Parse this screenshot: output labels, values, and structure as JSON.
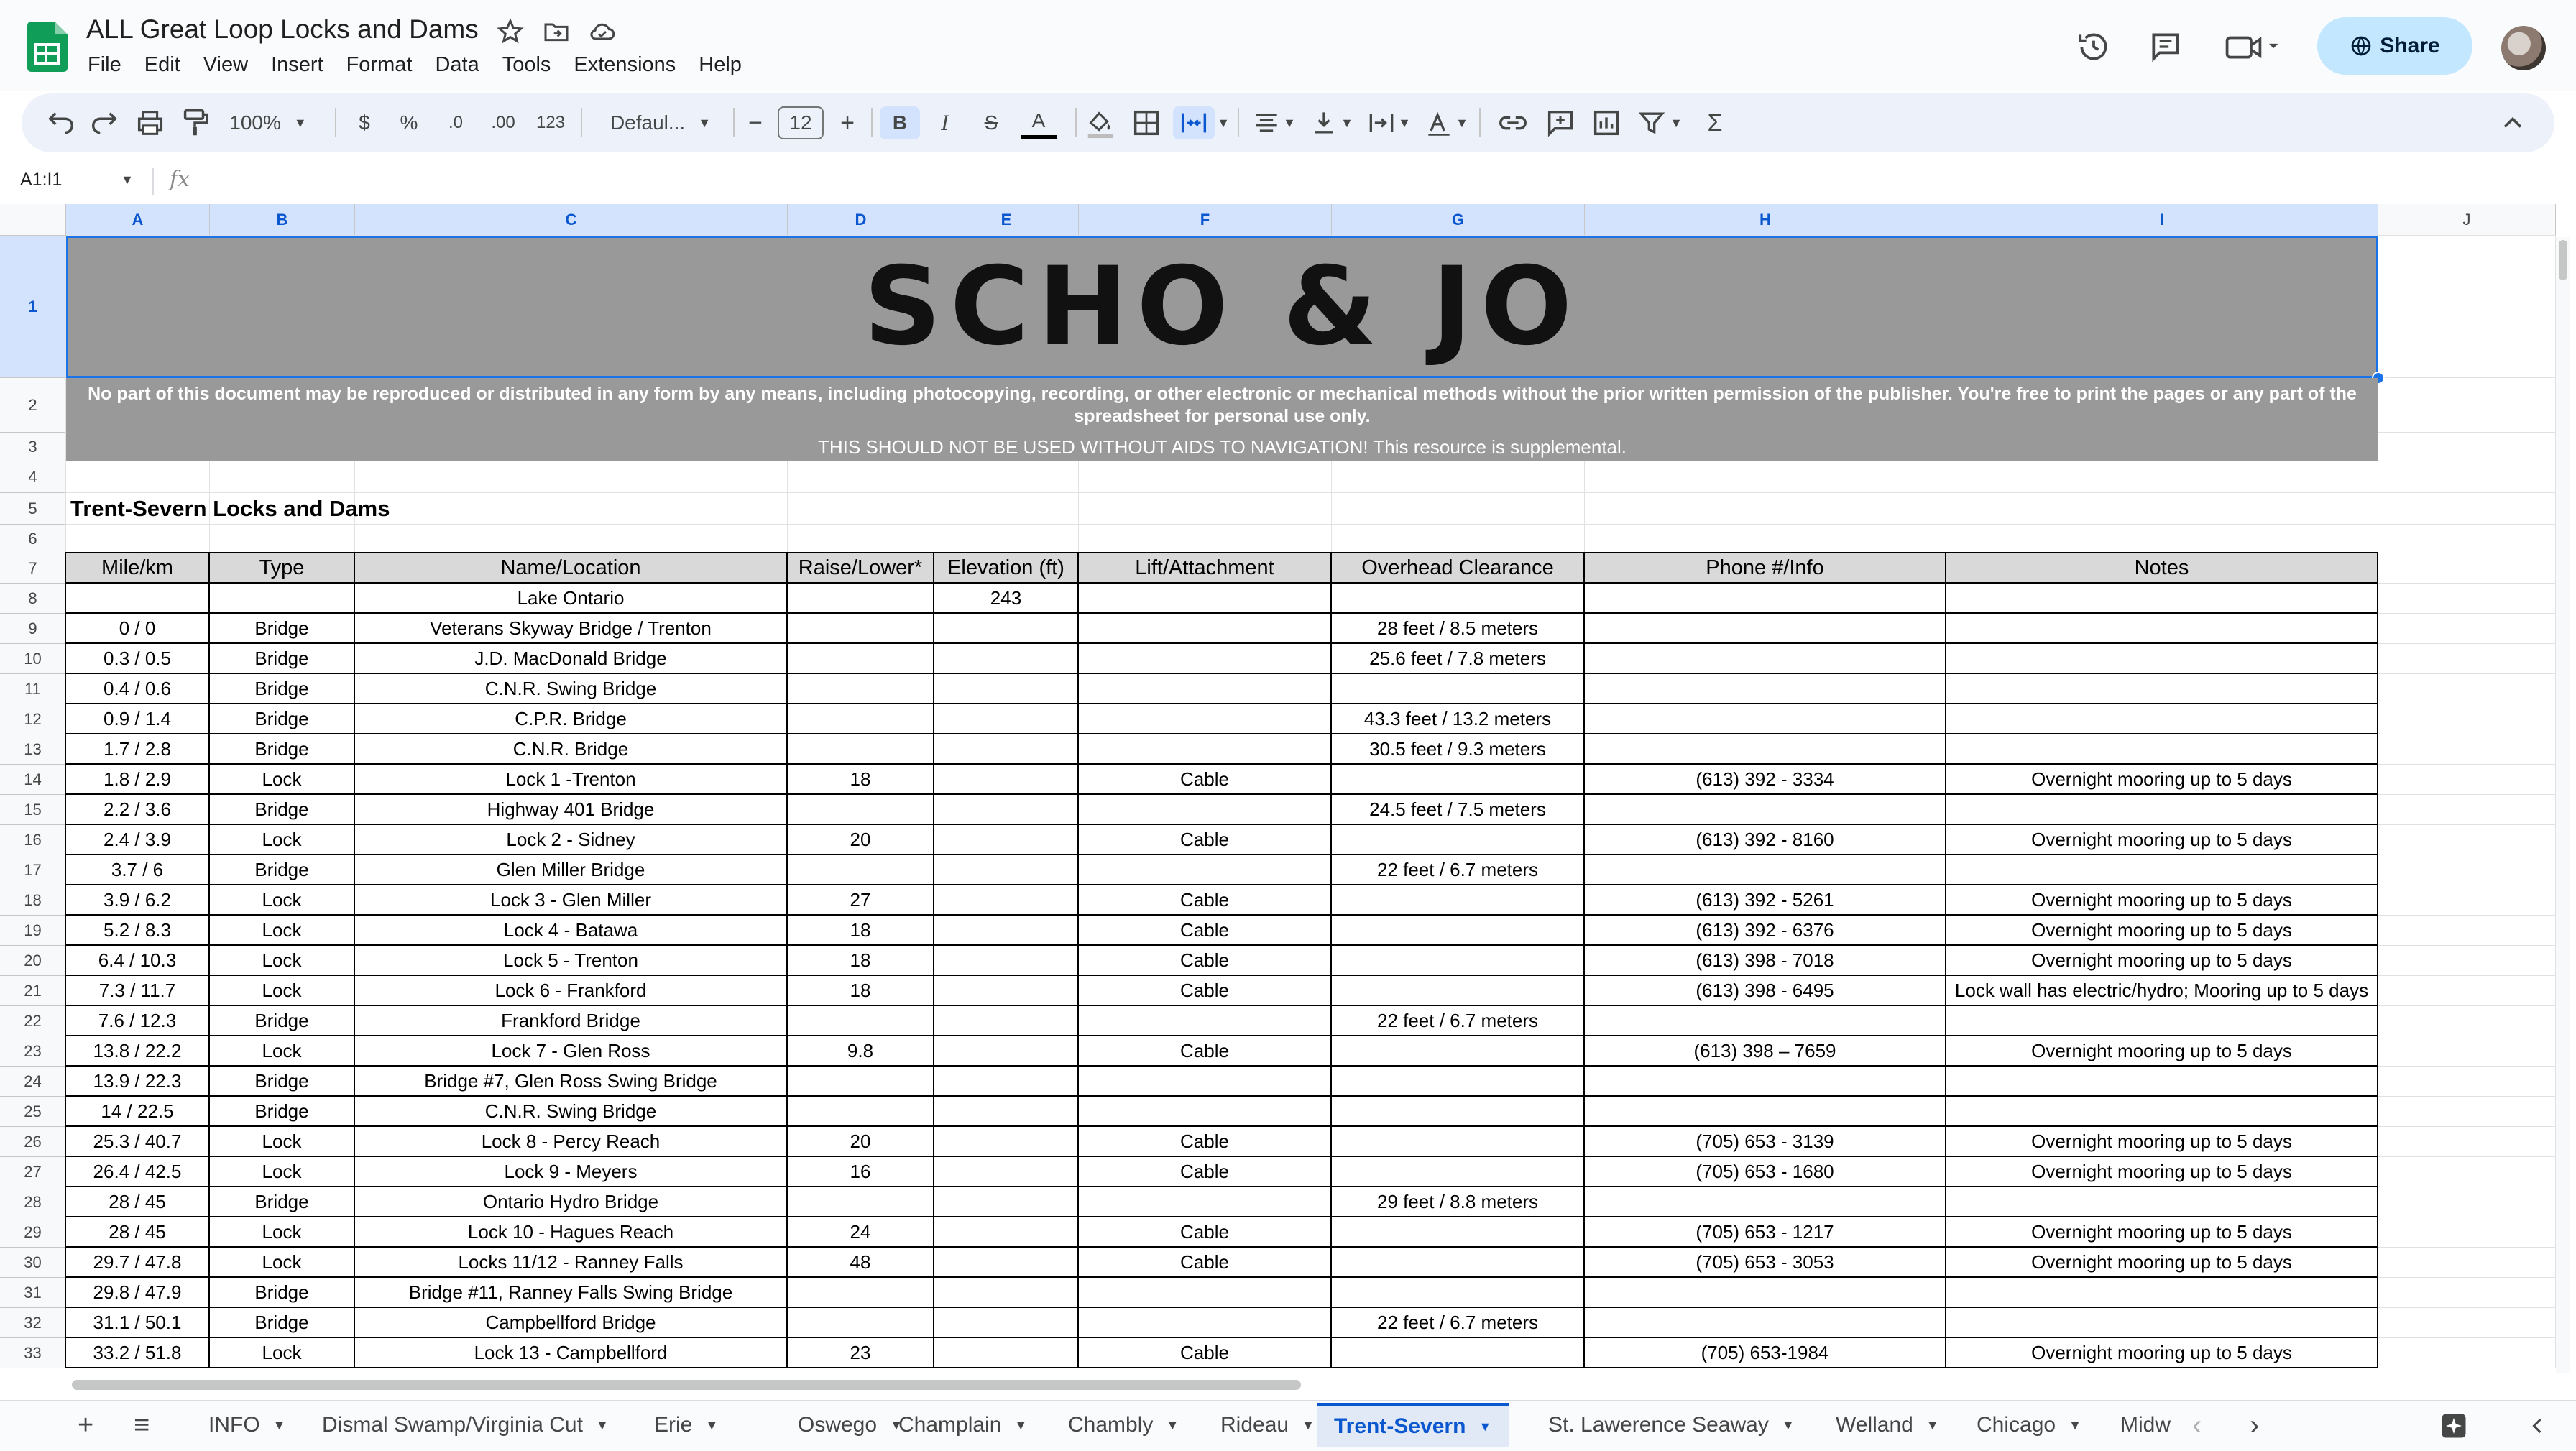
{
  "app": {
    "doc_title": "ALL Great Loop Locks and Dams",
    "menu": [
      "File",
      "Edit",
      "View",
      "Insert",
      "Format",
      "Data",
      "Tools",
      "Extensions",
      "Help"
    ],
    "share_label": "Share",
    "icons": [
      "sheets-logo",
      "star-icon",
      "move-folder-icon",
      "cloud-status-icon",
      "history-icon",
      "comments-icon",
      "meet-icon"
    ]
  },
  "toolbar": {
    "zoom": "100%",
    "currency": "$",
    "percent": "%",
    "decrease_decimal": ".0",
    "increase_decimal": ".00",
    "number_format": "123",
    "font": "Defaul...",
    "font_size": "12",
    "bold": "B",
    "italic": "I",
    "strike": "S",
    "text_color": "A",
    "minus": "−",
    "plus": "+"
  },
  "formula_bar": {
    "namebox": "A1:I1",
    "fx": "fx"
  },
  "columns": [
    "A",
    "B",
    "C",
    "D",
    "E",
    "F",
    "G",
    "H",
    "I",
    "J"
  ],
  "rows": [
    "1",
    "2",
    "3",
    "4",
    "5",
    "6",
    "7",
    "8",
    "9",
    "10",
    "11",
    "12",
    "13",
    "14",
    "15",
    "16",
    "17",
    "18",
    "19",
    "20",
    "21",
    "22",
    "23",
    "24",
    "25",
    "26",
    "27",
    "28",
    "29",
    "30",
    "31",
    "32",
    "33"
  ],
  "banner": {
    "logo_text": "SCHO & JO",
    "copyright": "No part of this document may be reproduced or distributed in any form by any means, including photocopying, recording, or other electronic or mechanical methods without the prior written permission of the publisher. You're free to print the pages or any part of the spreadsheet for personal use only.",
    "warning": "THIS SHOULD NOT BE USED WITHOUT AIDS TO NAVIGATION! This resource is supplemental."
  },
  "section_title": "Trent-Severn Locks and Dams",
  "table": {
    "headers": [
      "Mile/km",
      "Type",
      "Name/Location",
      "Raise/Lower*",
      "Elevation (ft)",
      "Lift/Attachment",
      "Overhead Clearance",
      "Phone #/Info",
      "Notes"
    ],
    "rows": [
      [
        "",
        "",
        "Lake Ontario",
        "",
        "243",
        "",
        "",
        "",
        ""
      ],
      [
        "0 / 0",
        "Bridge",
        "Veterans Skyway Bridge / Trenton",
        "",
        "",
        "",
        "28 feet / 8.5 meters",
        "",
        ""
      ],
      [
        "0.3 / 0.5",
        "Bridge",
        "J.D. MacDonald Bridge",
        "",
        "",
        "",
        "25.6 feet / 7.8 meters",
        "",
        ""
      ],
      [
        "0.4 / 0.6",
        "Bridge",
        "C.N.R. Swing Bridge",
        "",
        "",
        "",
        "",
        "",
        ""
      ],
      [
        "0.9 / 1.4",
        "Bridge",
        "C.P.R. Bridge",
        "",
        "",
        "",
        "43.3 feet / 13.2 meters",
        "",
        ""
      ],
      [
        "1.7 / 2.8",
        "Bridge",
        "C.N.R. Bridge",
        "",
        "",
        "",
        "30.5 feet / 9.3 meters",
        "",
        ""
      ],
      [
        "1.8 / 2.9",
        "Lock",
        "Lock 1 -Trenton",
        "18",
        "",
        "Cable",
        "",
        "(613) 392 - 3334",
        "Overnight mooring up to 5 days"
      ],
      [
        "2.2 / 3.6",
        "Bridge",
        "Highway 401 Bridge",
        "",
        "",
        "",
        "24.5 feet / 7.5 meters",
        "",
        ""
      ],
      [
        "2.4 / 3.9",
        "Lock",
        "Lock 2 - Sidney",
        "20",
        "",
        "Cable",
        "",
        "(613) 392 - 8160",
        "Overnight mooring up to 5 days"
      ],
      [
        "3.7 / 6",
        "Bridge",
        "Glen Miller Bridge",
        "",
        "",
        "",
        "22 feet / 6.7 meters",
        "",
        ""
      ],
      [
        "3.9 / 6.2",
        "Lock",
        "Lock 3 - Glen Miller",
        "27",
        "",
        "Cable",
        "",
        "(613) 392 - 5261",
        "Overnight mooring up to 5 days"
      ],
      [
        "5.2 / 8.3",
        "Lock",
        "Lock 4 - Batawa",
        "18",
        "",
        "Cable",
        "",
        "(613) 392 - 6376",
        "Overnight mooring up to 5 days"
      ],
      [
        "6.4 / 10.3",
        "Lock",
        "Lock 5 - Trenton",
        "18",
        "",
        "Cable",
        "",
        "(613) 398 - 7018",
        "Overnight mooring up to 5 days"
      ],
      [
        "7.3 / 11.7",
        "Lock",
        "Lock 6 - Frankford",
        "18",
        "",
        "Cable",
        "",
        "(613) 398 - 6495",
        "Lock wall has electric/hydro; Mooring up to 5 days"
      ],
      [
        "7.6 / 12.3",
        "Bridge",
        "Frankford Bridge",
        "",
        "",
        "",
        "22 feet / 6.7 meters",
        "",
        ""
      ],
      [
        "13.8 / 22.2",
        "Lock",
        "Lock 7 - Glen Ross",
        "9.8",
        "",
        "Cable",
        "",
        "(613) 398 – 7659",
        "Overnight mooring up to 5 days"
      ],
      [
        "13.9 / 22.3",
        "Bridge",
        "Bridge #7, Glen Ross Swing Bridge",
        "",
        "",
        "",
        "",
        "",
        ""
      ],
      [
        "14 / 22.5",
        "Bridge",
        "C.N.R. Swing Bridge",
        "",
        "",
        "",
        "",
        "",
        ""
      ],
      [
        "25.3 / 40.7",
        "Lock",
        "Lock 8 - Percy Reach",
        "20",
        "",
        "Cable",
        "",
        "(705) 653 - 3139",
        "Overnight mooring up to 5 days"
      ],
      [
        "26.4 / 42.5",
        "Lock",
        "Lock 9 - Meyers",
        "16",
        "",
        "Cable",
        "",
        "(705) 653 - 1680",
        "Overnight mooring up to 5 days"
      ],
      [
        "28 / 45",
        "Bridge",
        "Ontario Hydro Bridge",
        "",
        "",
        "",
        "29 feet / 8.8 meters",
        "",
        ""
      ],
      [
        "28 / 45",
        "Lock",
        "Lock 10 - Hagues Reach",
        "24",
        "",
        "Cable",
        "",
        "(705) 653 - 1217",
        "Overnight mooring up to 5 days"
      ],
      [
        "29.7 / 47.8",
        "Lock",
        "Locks 11/12 - Ranney Falls",
        "48",
        "",
        "Cable",
        "",
        "(705) 653 - 3053",
        "Overnight mooring up to 5 days"
      ],
      [
        "29.8 / 47.9",
        "Bridge",
        "Bridge #11, Ranney Falls Swing Bridge",
        "",
        "",
        "",
        "",
        "",
        ""
      ],
      [
        "31.1 / 50.1",
        "Bridge",
        "Campbellford Bridge",
        "",
        "",
        "",
        "22 feet / 6.7 meters",
        "",
        ""
      ],
      [
        "33.2 / 51.8",
        "Lock",
        "Lock 13 - Campbellford",
        "23",
        "",
        "Cable",
        "",
        "(705) 653-1984",
        "Overnight mooring up to 5 days"
      ]
    ]
  },
  "sheet_tabs": {
    "add": "+",
    "list": "≡",
    "tabs": [
      "INFO",
      "Dismal Swamp/Virginia Cut",
      "Erie",
      "Oswego",
      "Champlain",
      "Chambly",
      "Rideau",
      "Trent-Severn",
      "St. Lawerence Seaway",
      "Welland",
      "Chicago",
      "Midw"
    ],
    "active": "Trent-Severn",
    "prev": "‹",
    "next": "›"
  },
  "colors": {
    "accent": "#0b57d0",
    "banner_gray": "#999999",
    "header_gray": "#d9d9d9",
    "share_bg": "#c2e7ff"
  }
}
